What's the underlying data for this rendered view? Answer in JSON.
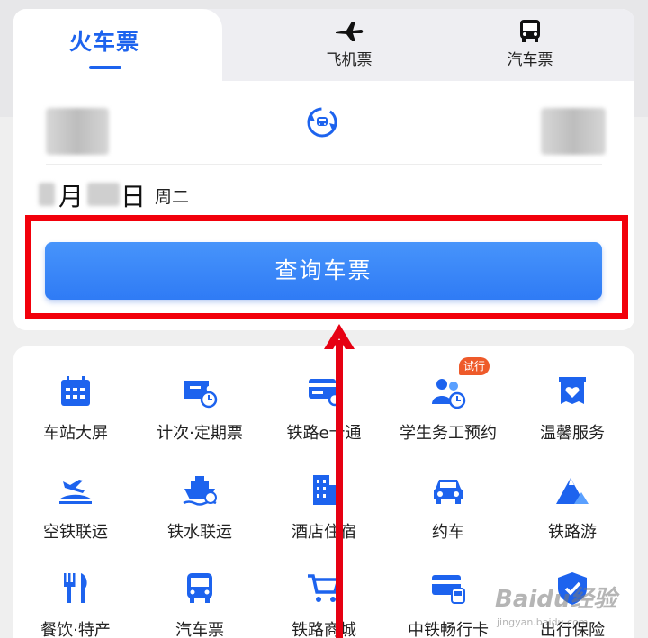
{
  "tabs": {
    "train": "火车票",
    "flight": "飞机票",
    "bus": "汽车票"
  },
  "booking": {
    "date_month_char": "月",
    "date_day_char": "日",
    "weekday": "周二",
    "search_button": "查询车票"
  },
  "services": [
    {
      "label": "车站大屏",
      "icon": "calendar-icon"
    },
    {
      "label": "计次·定期票",
      "icon": "ticket-clock-icon"
    },
    {
      "label": "铁路e卡通",
      "icon": "card-icon"
    },
    {
      "label": "学生务工预约",
      "icon": "people-clock-icon"
    },
    {
      "label": "温馨服务",
      "icon": "heart-box-icon"
    },
    {
      "label": "空铁联运",
      "icon": "plane-train-icon"
    },
    {
      "label": "铁水联运",
      "icon": "ship-icon"
    },
    {
      "label": "酒店住宿",
      "icon": "hotel-icon"
    },
    {
      "label": "约车",
      "icon": "car-icon"
    },
    {
      "label": "铁路游",
      "icon": "mountain-icon"
    },
    {
      "label": "餐饮·特产",
      "icon": "fork-knife-icon"
    },
    {
      "label": "汽车票",
      "icon": "bus-icon"
    },
    {
      "label": "铁路商城",
      "icon": "cart-icon"
    },
    {
      "label": "中铁畅行卡",
      "icon": "card-train-icon"
    },
    {
      "label": "出行保险",
      "icon": "shield-icon"
    }
  ],
  "badge": "试行",
  "watermark": {
    "main": "Baidu经验",
    "sub": "jingyan.baidu.com"
  },
  "colors": {
    "accent": "#1d63ee",
    "button": "#3a86f8",
    "highlight": "#f2000b"
  }
}
